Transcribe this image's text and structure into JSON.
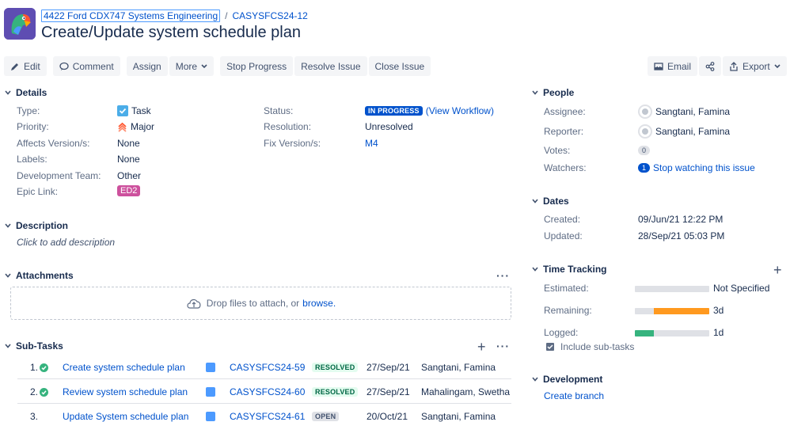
{
  "header": {
    "project": "4422 Ford CDX747 Systems Engineering",
    "separator": "/",
    "issue_key": "CASYSFCS24-12",
    "title": "Create/Update system schedule plan"
  },
  "toolbar": {
    "edit": "Edit",
    "comment": "Comment",
    "assign": "Assign",
    "more": "More",
    "stop_progress": "Stop Progress",
    "resolve_issue": "Resolve Issue",
    "close_issue": "Close Issue",
    "email": "Email",
    "export": "Export"
  },
  "details": {
    "heading": "Details",
    "type_label": "Type:",
    "type_value": "Task",
    "priority_label": "Priority:",
    "priority_value": "Major",
    "affects_label": "Affects Version/s:",
    "affects_value": "None",
    "labels_label": "Labels:",
    "labels_value": "None",
    "devteam_label": "Development Team:",
    "devteam_value": "Other",
    "epic_label": "Epic Link:",
    "epic_value": "ED2",
    "status_label": "Status:",
    "status_value": "IN PROGRESS",
    "workflow_link": "(View Workflow)",
    "resolution_label": "Resolution:",
    "resolution_value": "Unresolved",
    "fix_label": "Fix Version/s:",
    "fix_value": "M4"
  },
  "description": {
    "heading": "Description",
    "placeholder": "Click to add description"
  },
  "attachments": {
    "heading": "Attachments",
    "drop_text": "Drop files to attach, or",
    "browse": "browse."
  },
  "subtasks": {
    "heading": "Sub-Tasks",
    "rows": [
      {
        "num": "1.",
        "summary": "Create system schedule plan",
        "key": "CASYSFCS24-59",
        "status": "RESOLVED",
        "date": "27/Sep/21",
        "assignee": "Sangtani, Famina",
        "done": true
      },
      {
        "num": "2.",
        "summary": "Review system schedule plan",
        "key": "CASYSFCS24-60",
        "status": "RESOLVED",
        "date": "27/Sep/21",
        "assignee": "Mahalingam, Swetha",
        "done": true
      },
      {
        "num": "3.",
        "summary": "Update System schedule plan",
        "key": "CASYSFCS24-61",
        "status": "OPEN",
        "date": "20/Oct/21",
        "assignee": "Sangtani, Famina",
        "done": false
      }
    ]
  },
  "people": {
    "heading": "People",
    "assignee_label": "Assignee:",
    "assignee": "Sangtani, Famina",
    "reporter_label": "Reporter:",
    "reporter": "Sangtani, Famina",
    "votes_label": "Votes:",
    "votes": "0",
    "watchers_label": "Watchers:",
    "watchers": "1",
    "watch_link": "Stop watching this issue"
  },
  "dates": {
    "heading": "Dates",
    "created_label": "Created:",
    "created": "09/Jun/21 12:22 PM",
    "updated_label": "Updated:",
    "updated": "28/Sep/21 05:03 PM"
  },
  "time_tracking": {
    "heading": "Time Tracking",
    "estimated_label": "Estimated:",
    "estimated": "Not Specified",
    "remaining_label": "Remaining:",
    "remaining": "3d",
    "remaining_fraction": 0.75,
    "logged_label": "Logged:",
    "logged": "1d",
    "logged_fraction": 0.25,
    "include_subtasks": "Include sub-tasks"
  },
  "development": {
    "heading": "Development",
    "create_branch": "Create branch"
  },
  "colors": {
    "accent": "#0052cc",
    "remaining": "#ff991f",
    "logged": "#36b37e",
    "epic": "#cd519d"
  }
}
